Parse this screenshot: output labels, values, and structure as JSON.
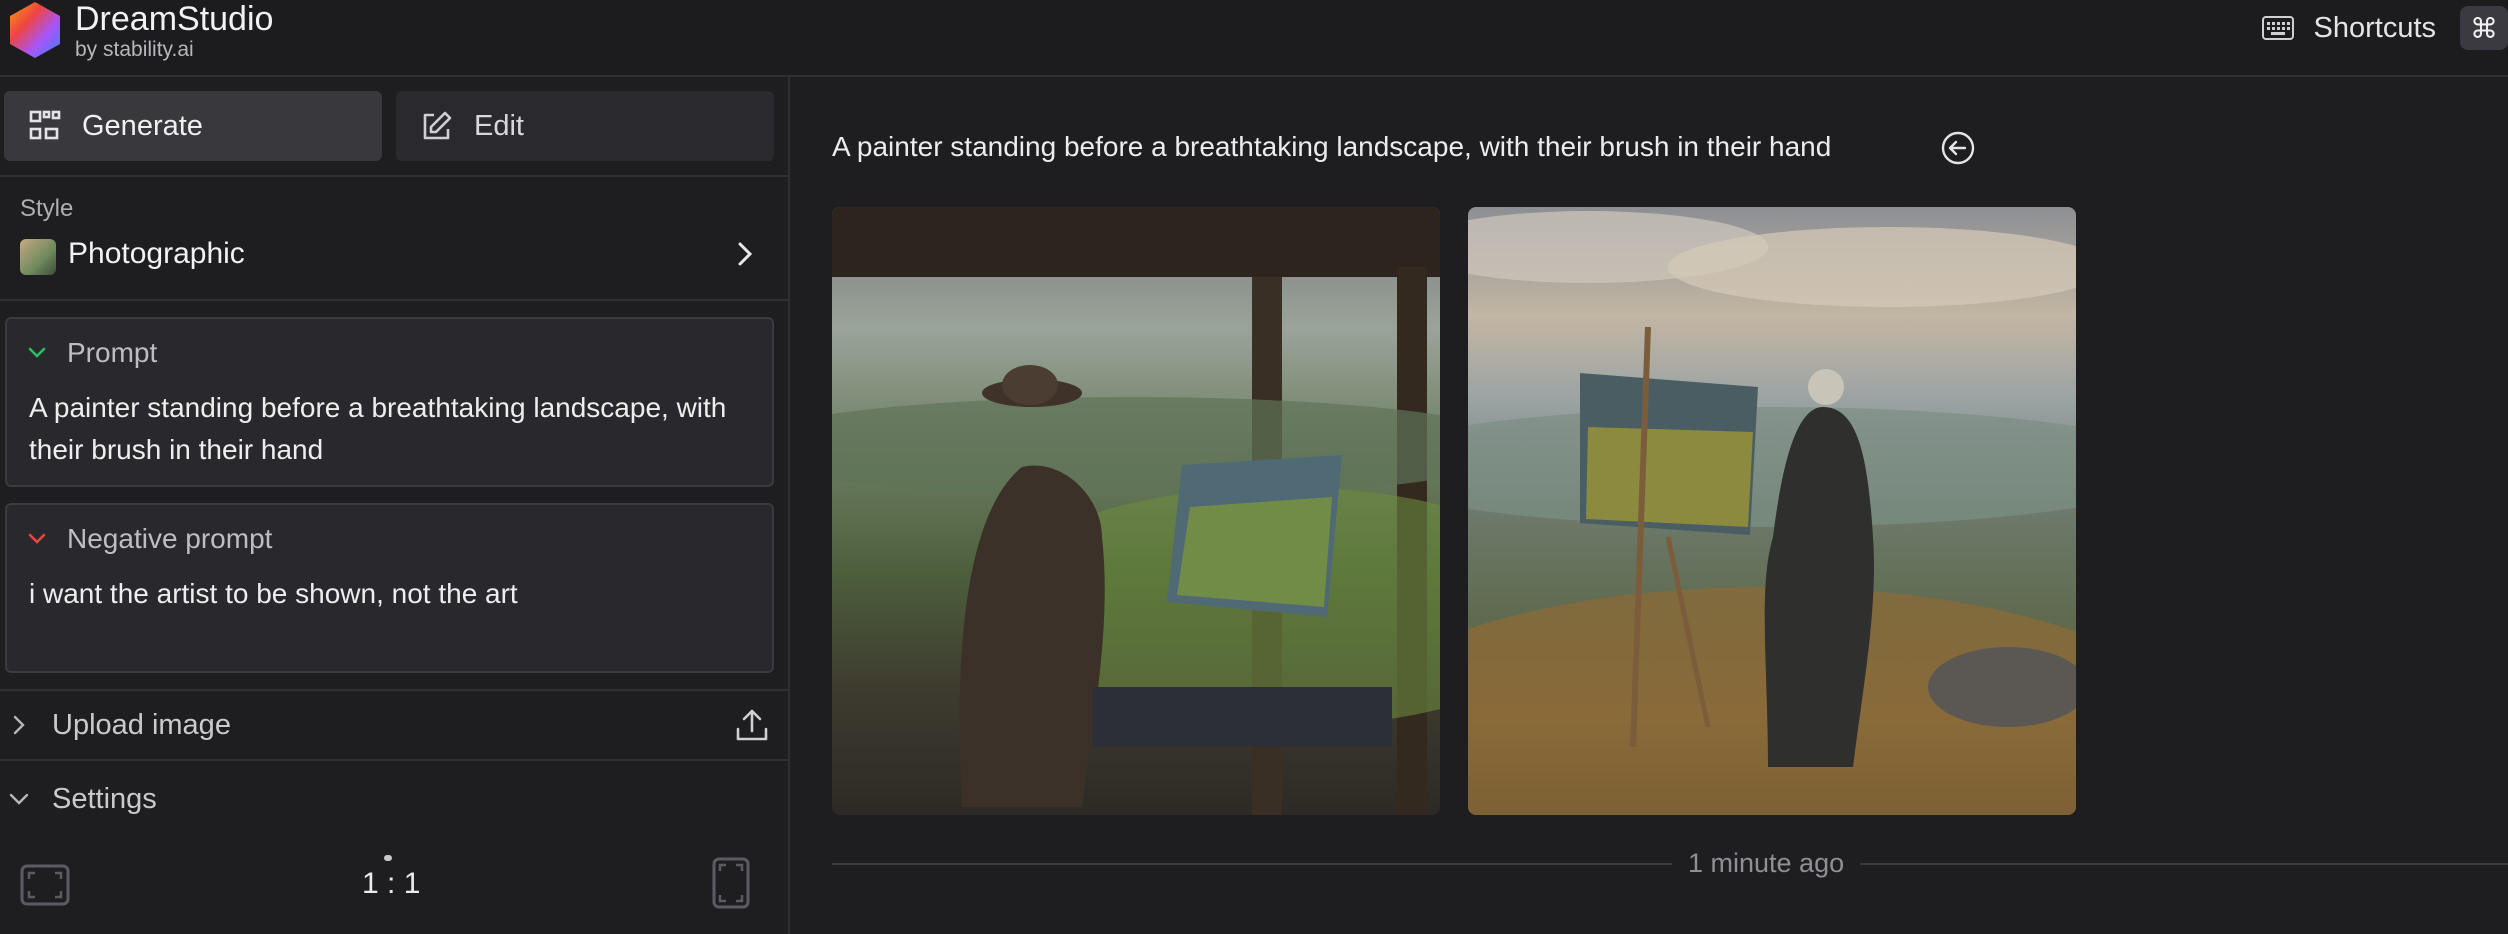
{
  "header": {
    "brand_title": "DreamStudio",
    "brand_sub": "by stability.ai",
    "shortcuts_label": "Shortcuts",
    "cmd_key": "⌘"
  },
  "sidebar": {
    "modes": [
      {
        "label": "Generate",
        "icon": "grid-icon",
        "active": true
      },
      {
        "label": "Edit",
        "icon": "pencil-square-icon",
        "active": false
      }
    ],
    "style": {
      "label": "Style",
      "value": "Photographic"
    },
    "prompt": {
      "label": "Prompt",
      "text": "A painter standing before a breathtaking landscape, with their brush in their hand",
      "accent": "#22c55e"
    },
    "negative_prompt": {
      "label": "Negative prompt",
      "text": "i want the artist to be shown, not the art",
      "accent": "#ef4444"
    },
    "upload": {
      "label": "Upload image"
    },
    "settings": {
      "label": "Settings"
    },
    "aspect_ratio": {
      "label": "1 : 1"
    }
  },
  "main": {
    "prompt_text": "A painter standing before a breathtaking landscape, with their brush in their hand",
    "images": [
      {
        "name": "generated-image-1"
      },
      {
        "name": "generated-image-2"
      }
    ],
    "timestamp": "1 minute ago"
  }
}
